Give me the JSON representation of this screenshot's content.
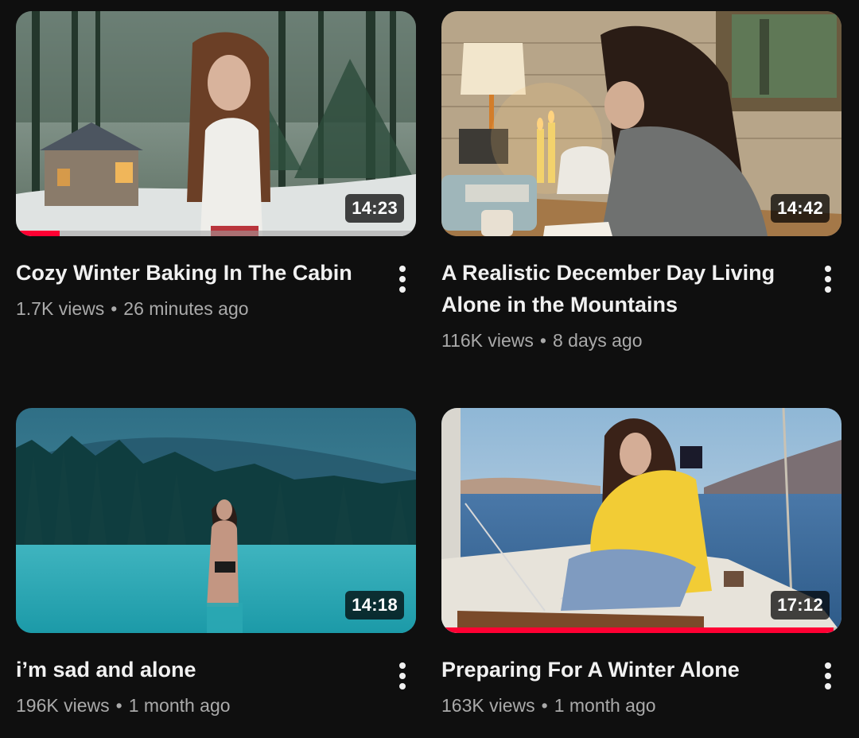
{
  "videos": [
    {
      "title": "Cozy Winter Baking In The Cabin",
      "views": "1.7K views",
      "age": "26 minutes ago",
      "duration": "14:23",
      "watched": 0.11,
      "thumbnail": "cabin-in-snowy-forest"
    },
    {
      "title": "A Realistic December Day Living Alone in the Mountains",
      "views": "116K views",
      "age": "8 days ago",
      "duration": "14:42",
      "watched": 0,
      "thumbnail": "writing-by-candlelight"
    },
    {
      "title": "i’m sad and alone",
      "views": "196K views",
      "age": "1 month ago",
      "duration": "14:18",
      "watched": 0,
      "thumbnail": "turquoise-lake-forest"
    },
    {
      "title": "Preparing For A Winter Alone",
      "views": "163K views",
      "age": "1 month ago",
      "duration": "17:12",
      "watched": 0.98,
      "thumbnail": "sailboat-yellow-jacket"
    }
  ],
  "separator": "•",
  "colors": {
    "background": "#0f0f0f",
    "title": "#f1f1f1",
    "meta": "#aaaaaa",
    "progress": "#ff0033"
  }
}
